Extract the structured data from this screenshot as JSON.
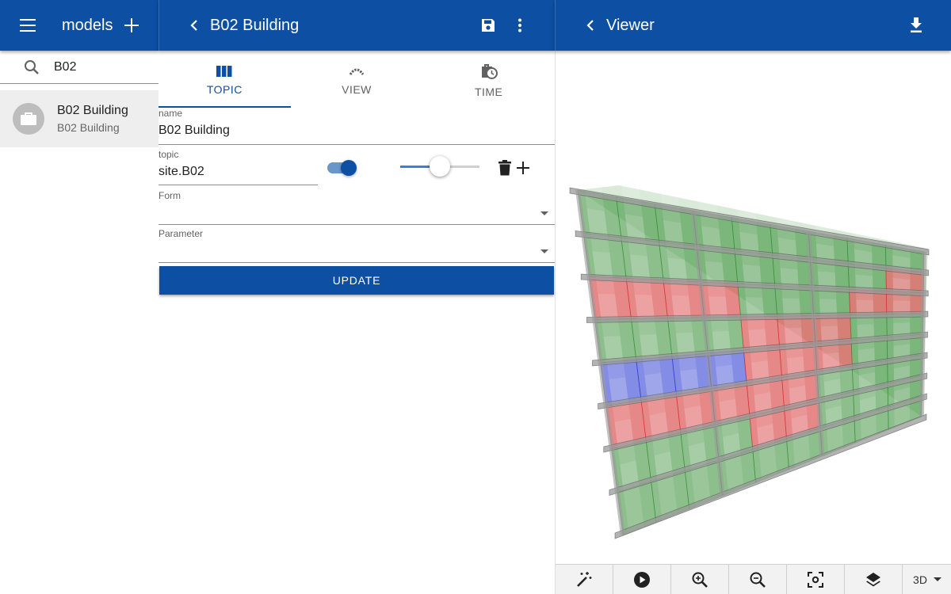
{
  "left_panel": {
    "title": "models",
    "search": {
      "value": "B02",
      "placeholder": ""
    },
    "items": [
      {
        "primary": "B02 Building",
        "secondary": "B02 Building"
      }
    ]
  },
  "middle_panel": {
    "title": "B02 Building",
    "tabs": [
      {
        "label": "TOPIC",
        "icon": "columns-icon",
        "active": true
      },
      {
        "label": "VIEW",
        "icon": "view-icon",
        "active": false
      },
      {
        "label": "TIME",
        "icon": "time-icon",
        "active": false
      }
    ],
    "name_field": {
      "label": "name",
      "value": "B02 Building"
    },
    "topic_field": {
      "label": "topic",
      "value": "site.B02",
      "toggle_on": true,
      "opacity": 0.5
    },
    "form_field": {
      "label": "Form",
      "value": ""
    },
    "parameter_field": {
      "label": "Parameter",
      "value": ""
    },
    "update_label": "UPDATE"
  },
  "right_panel": {
    "title": "Viewer",
    "toolbar": {
      "buttons": [
        "magic-wand-icon",
        "play-icon",
        "zoom-in-icon",
        "zoom-out-icon",
        "focus-icon",
        "layers-icon"
      ],
      "mode": "3D"
    }
  },
  "colors": {
    "primary": "#0d4fa3",
    "floor_green": "#2e8b2e",
    "floor_red": "#d42626",
    "floor_blue": "#1f2fd0",
    "slab_gray": "#9a9a9a"
  }
}
